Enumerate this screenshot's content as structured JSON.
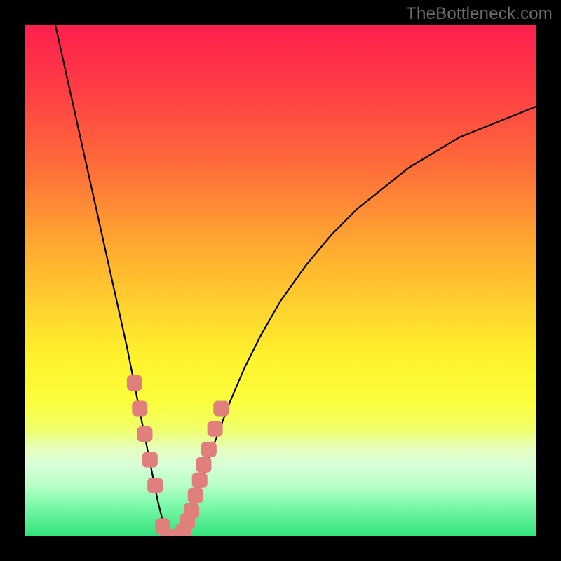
{
  "watermark": "TheBottleneck.com",
  "colors": {
    "frame": "#000000",
    "marker": "#e07f7c",
    "curve": "#000000",
    "watermark_text": "#6e6e6e"
  },
  "chart_data": {
    "type": "line",
    "title": "",
    "xlabel": "",
    "ylabel": "",
    "xlim": [
      0,
      100
    ],
    "ylim": [
      0,
      100
    ],
    "series": [
      {
        "name": "bottleneck-curve",
        "x": [
          6,
          8,
          10,
          12,
          14,
          16,
          18,
          20,
          21,
          22,
          23,
          24,
          25,
          26,
          27,
          28,
          29,
          30,
          31,
          32,
          33,
          35,
          37,
          40,
          43,
          46,
          50,
          55,
          60,
          65,
          70,
          75,
          80,
          85,
          90,
          95,
          100
        ],
        "y": [
          100,
          91,
          82,
          73,
          64,
          55,
          46,
          37,
          32,
          27,
          22,
          17,
          12,
          7,
          3,
          1,
          0,
          0,
          1,
          3,
          6,
          12,
          18,
          26,
          33,
          39,
          46,
          53,
          59,
          64,
          68,
          72,
          75,
          78,
          80,
          82,
          84
        ]
      }
    ],
    "markers": {
      "name": "highlighted-points",
      "x": [
        21.5,
        22.5,
        23.5,
        24.5,
        25.5,
        27.0,
        28.0,
        29.0,
        30.0,
        31.0,
        31.8,
        32.6,
        33.4,
        34.2,
        35.0,
        36.0,
        37.2,
        38.4
      ],
      "y": [
        30,
        25,
        20,
        15,
        10,
        2,
        0,
        0,
        0,
        1,
        3,
        5,
        8,
        11,
        14,
        17,
        21,
        25
      ]
    },
    "gradient_stops": [
      {
        "pct": 0,
        "color": "#ff1f4e"
      },
      {
        "pct": 12,
        "color": "#ff3b45"
      },
      {
        "pct": 28,
        "color": "#ff6e39"
      },
      {
        "pct": 42,
        "color": "#ffa531"
      },
      {
        "pct": 55,
        "color": "#ffd22e"
      },
      {
        "pct": 65,
        "color": "#fff22d"
      },
      {
        "pct": 74,
        "color": "#fbff3e"
      },
      {
        "pct": 79,
        "color": "#f0ff6a"
      },
      {
        "pct": 83,
        "color": "#e6ffc0"
      },
      {
        "pct": 86,
        "color": "#d8ffd8"
      },
      {
        "pct": 90,
        "color": "#b8ffc8"
      },
      {
        "pct": 94,
        "color": "#7cf9a8"
      },
      {
        "pct": 100,
        "color": "#32e27a"
      }
    ]
  }
}
